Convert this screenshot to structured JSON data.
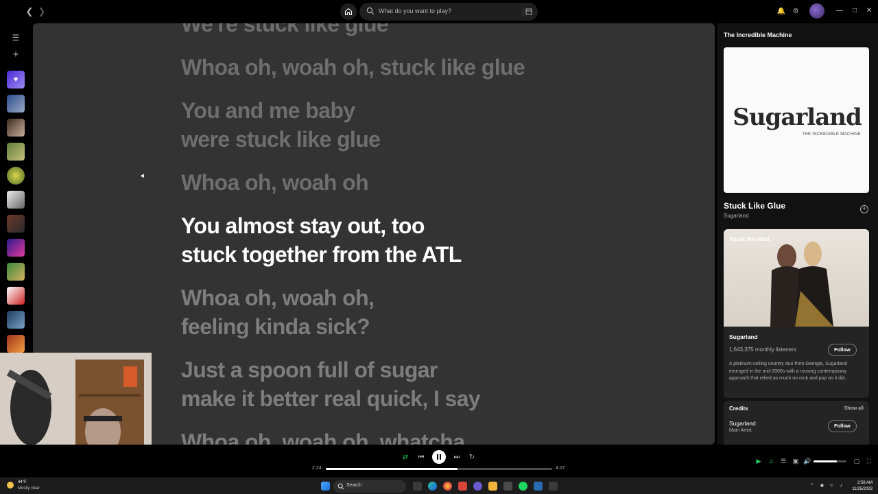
{
  "topbar": {
    "search_placeholder": "What do you want to play?"
  },
  "lyrics": [
    {
      "text": "We're stuck like glue",
      "state": "past"
    },
    {
      "text": "Whoa oh, woah oh, stuck like glue",
      "state": "past"
    },
    {
      "text": "You and me baby\nwere stuck like glue",
      "state": "past"
    },
    {
      "text": "Whoa oh, woah oh",
      "state": "past"
    },
    {
      "text": "You almost stay out, too\nstuck together from the ATL",
      "state": "active"
    },
    {
      "text": "Whoa oh, woah oh,\nfeeling kinda sick?",
      "state": "upcoming"
    },
    {
      "text": "Just a spoon full of sugar\nmake it better real quick, I say",
      "state": "upcoming"
    },
    {
      "text": "Whoa oh, woah oh, whatcha",
      "state": "upcoming"
    }
  ],
  "now_playing_panel": {
    "header": "The Incredible Machine",
    "album_brand": "Sugarland",
    "album_subtitle": "THE INCREDIBLE MACHINE",
    "track_title": "Stuck Like Glue",
    "track_artist": "Sugarland",
    "about": {
      "label": "About the artist",
      "artist": "Sugarland",
      "listeners": "1,643,375 monthly listeners",
      "follow_label": "Follow",
      "bio": "A platinum-selling country duo from Georgia, Sugarland emerged in the mid-2000s with a rousing contemporary approach that relied as much on rock and pop as it did..."
    },
    "credits": {
      "title": "Credits",
      "show_all": "Show all",
      "name": "Sugarland",
      "role": "Main Artist",
      "follow_label": "Follow"
    }
  },
  "player": {
    "elapsed": "2:24",
    "duration": "4:07",
    "progress": 0.583,
    "volume": 0.7
  },
  "taskbar": {
    "weather_temp": "44°F",
    "weather_cond": "Mostly clear",
    "search_label": "Search",
    "time": "2:58 AM",
    "date": "11/25/2023"
  },
  "colors": {
    "accent": "#1ed760",
    "lyrics_bg": "#333333",
    "panel_bg": "#121212"
  }
}
